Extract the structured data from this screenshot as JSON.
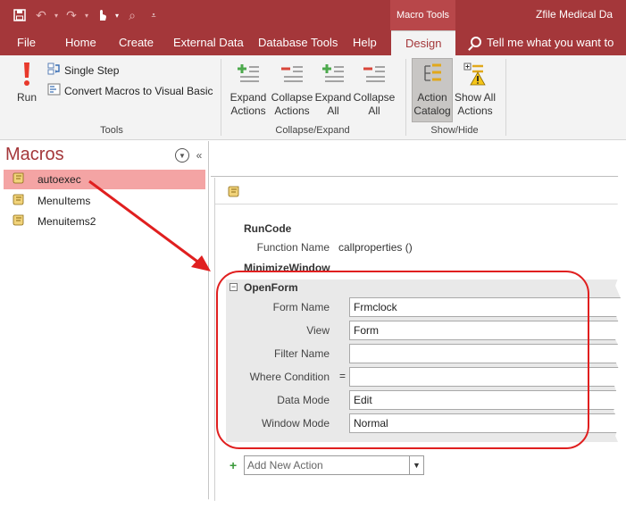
{
  "title_bar": {
    "context_tab_title": "Macro Tools",
    "app_title": "Zfile Medical Da"
  },
  "ribbon_tabs": [
    {
      "label": "File"
    },
    {
      "label": "Home"
    },
    {
      "label": "Create"
    },
    {
      "label": "External Data"
    },
    {
      "label": "Database Tools"
    },
    {
      "label": "Help"
    },
    {
      "label": "Design",
      "active": true
    }
  ],
  "tell_me": "Tell me what you want to",
  "ribbon": {
    "tools": {
      "run_label": "Run",
      "single_step_label": "Single Step",
      "convert_label": "Convert Macros to Visual Basic",
      "group_label": "Tools"
    },
    "collapse_expand": {
      "expand_actions": "Expand\nActions",
      "collapse_actions": "Collapse\nActions",
      "expand_all": "Expand\nAll",
      "collapse_all": "Collapse\nAll",
      "group_label": "Collapse/Expand"
    },
    "show_hide": {
      "action_catalog": "Action\nCatalog",
      "show_all_actions": "Show All\nActions",
      "group_label": "Show/Hide"
    }
  },
  "nav_pane": {
    "title": "Macros",
    "items": [
      {
        "label": "autoexec",
        "selected": true
      },
      {
        "label": "MenuItems"
      },
      {
        "label": "Menuitems2"
      }
    ]
  },
  "macro": {
    "runcode": {
      "name": "RunCode",
      "function_name_label": "Function Name",
      "function_name_value": "callproperties ()"
    },
    "minimize": {
      "name": "MinimizeWindow"
    },
    "openform": {
      "name": "OpenForm",
      "collapse_glyph": "−",
      "args": [
        {
          "label": "Form Name",
          "value": "Frmclock"
        },
        {
          "label": "View",
          "value": "Form"
        },
        {
          "label": "Filter Name",
          "value": ""
        },
        {
          "label": "Where Condition",
          "prefix": "=",
          "value": ""
        },
        {
          "label": "Data Mode",
          "value": "Edit"
        },
        {
          "label": "Window Mode",
          "value": "Normal"
        }
      ]
    },
    "add_action_placeholder": "Add New Action"
  },
  "colors": {
    "access_brand": "#a4373a",
    "annotation_red": "#e01f1f",
    "selected_item": "#f4a4a4"
  }
}
